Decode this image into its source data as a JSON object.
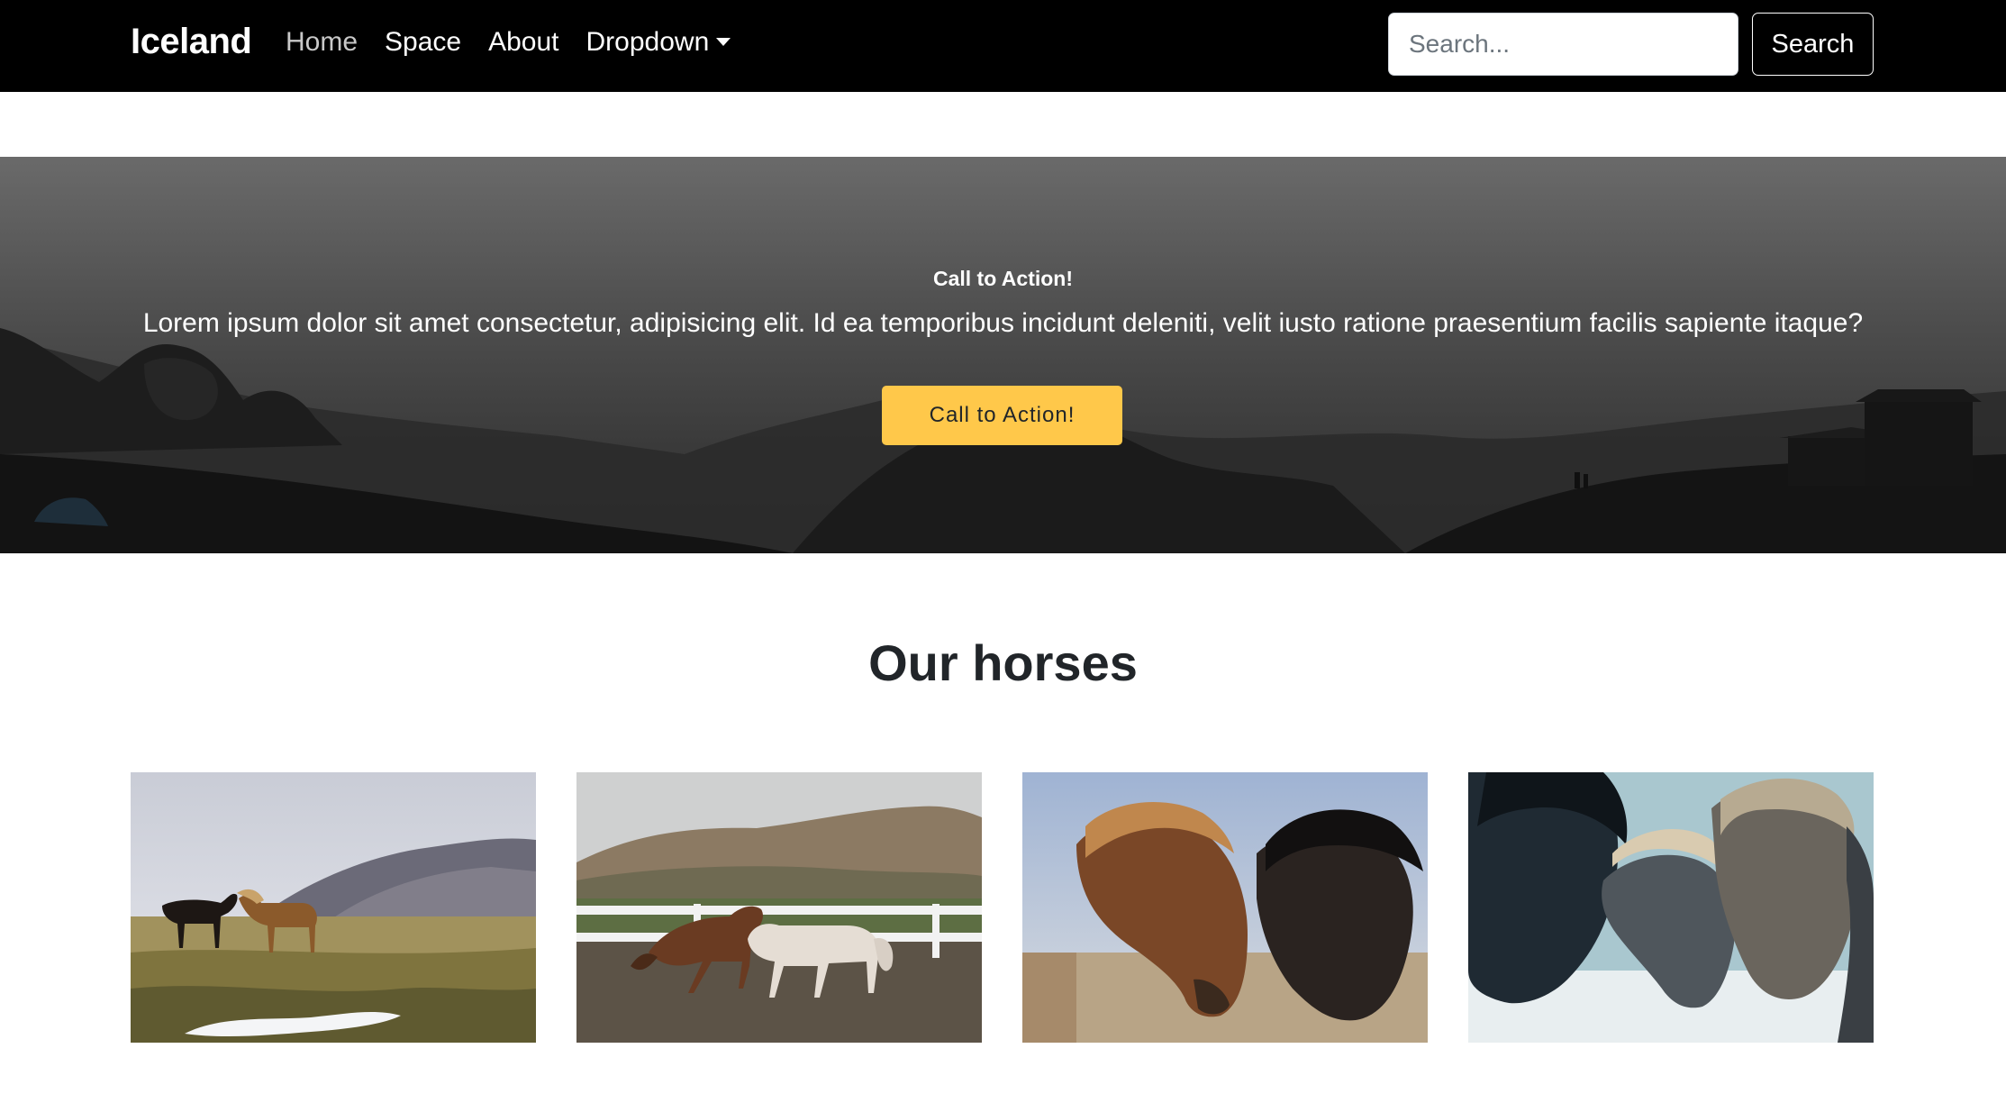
{
  "navbar": {
    "brand": "Iceland",
    "links": [
      {
        "label": "Home"
      },
      {
        "label": "Space"
      },
      {
        "label": "About"
      },
      {
        "label": "Dropdown"
      }
    ],
    "search": {
      "placeholder": "Search...",
      "button_label": "Search"
    }
  },
  "hero": {
    "eyebrow": "Call to Action!",
    "text": "Lorem ipsum dolor sit amet consectetur, adipisicing elit. Id ea temporibus incidunt deleniti, velit iusto ratione praesentium facilis sapiente itaque?",
    "button_label": "Call to Action!"
  },
  "horses_section": {
    "title": "Our horses"
  },
  "colors": {
    "navbar_bg": "#000000",
    "cta_button": "#ffc84a",
    "page_bg": "#ffffff",
    "text_dark": "#212529"
  },
  "icons": {
    "dropdown": "caret-down-icon"
  }
}
